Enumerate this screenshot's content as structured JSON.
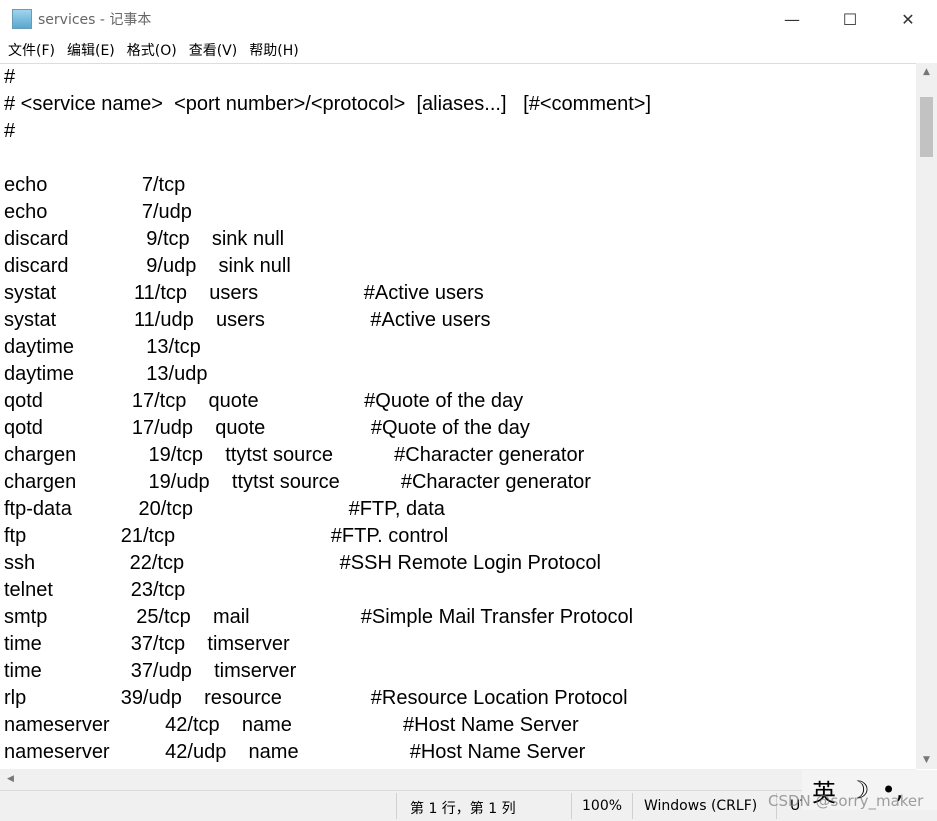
{
  "window": {
    "title": "services - 记事本",
    "minimize": "—",
    "maximize": "☐",
    "close": "✕"
  },
  "menu": [
    "文件(F)",
    "编辑(E)",
    "格式(O)",
    "查看(V)",
    "帮助(H)"
  ],
  "content": "#\n# <service name>  <port number>/<protocol>  [aliases...]   [#<comment>]\n#\n\necho                 7/tcp\necho                 7/udp\ndiscard              9/tcp    sink null\ndiscard              9/udp    sink null\nsystat              11/tcp    users                   #Active users\nsystat              11/udp    users                   #Active users\ndaytime             13/tcp\ndaytime             13/udp\nqotd                17/tcp    quote                   #Quote of the day\nqotd                17/udp    quote                   #Quote of the day\nchargen             19/tcp    ttytst source           #Character generator\nchargen             19/udp    ttytst source           #Character generator\nftp-data            20/tcp                            #FTP, data\nftp                 21/tcp                            #FTP. control\nssh                 22/tcp                            #SSH Remote Login Protocol\ntelnet              23/tcp\nsmtp                25/tcp    mail                    #Simple Mail Transfer Protocol\ntime                37/tcp    timserver\ntime                37/udp    timserver\nrlp                 39/udp    resource                #Resource Location Protocol\nnameserver          42/tcp    name                    #Host Name Server\nnameserver          42/udp    name                    #Host Name Server",
  "status": {
    "position": "第 1 行，第 1 列",
    "zoom": "100%",
    "line_ending": "Windows (CRLF)",
    "encoding": "UTF-8"
  },
  "ime": {
    "lang": "英",
    "moon": "☽",
    "punct": "•,"
  },
  "watermark": "CSDN @sorry_maker"
}
